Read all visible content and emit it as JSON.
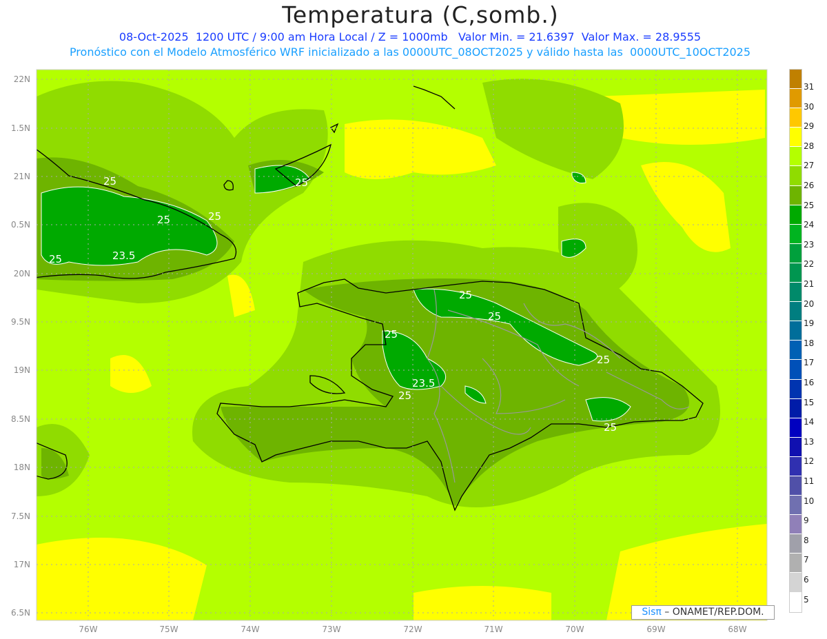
{
  "title": "Temperatura (C,somb.)",
  "subtitle_line1": "08-Oct-2025  1200 UTC / 9:00 am Hora Local / Z = 1000mb   Valor Min. = 21.6397  Valor Max. = 28.9555",
  "subtitle_line2": "Pronóstico con el Modelo Atmosférico WRF inicializado a las 0000UTC_08OCT2025 y válido hasta las  0000UTC_10OCT2025",
  "lat_labels": [
    "22N",
    "1.5N",
    "21N",
    "0.5N",
    "20N",
    "9.5N",
    "19N",
    "8.5N",
    "18N",
    "7.5N",
    "17N",
    "6.5N"
  ],
  "lon_labels": [
    "76W",
    "75W",
    "74W",
    "73W",
    "72W",
    "71W",
    "70W",
    "69W",
    "68W"
  ],
  "colorbar": {
    "labels": [
      "31",
      "30",
      "29",
      "28",
      "27",
      "26",
      "25",
      "24",
      "23",
      "22",
      "21",
      "20",
      "19",
      "18",
      "17",
      "16",
      "15",
      "14",
      "13",
      "12",
      "11",
      "10",
      "9",
      "8",
      "7",
      "6",
      "5"
    ],
    "colors": [
      "#c08000",
      "#e09a00",
      "#ffc800",
      "#ffff00",
      "#b4ff00",
      "#90dc00",
      "#6eb400",
      "#00aa00",
      "#00b420",
      "#00a03c",
      "#009650",
      "#008a6a",
      "#007e80",
      "#006e9a",
      "#0060b4",
      "#0050b8",
      "#0034b0",
      "#001ca8",
      "#0000c0",
      "#1010b0",
      "#3030b0",
      "#5050a8",
      "#7070b0",
      "#9080b8",
      "#a0a0aa",
      "#b0b0b0",
      "#d4d4d4",
      "#ffffff"
    ]
  },
  "contour_labels": [
    "25",
    "25",
    "25",
    "25",
    "25",
    "23.5",
    "25",
    "25",
    "25",
    "25",
    "23.5",
    "25",
    "25",
    "25"
  ],
  "credit": {
    "brand": "Sisπ",
    "text": " –  ONAMET/REP.DOM."
  }
}
